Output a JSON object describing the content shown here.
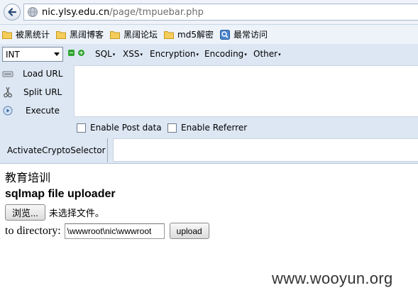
{
  "browser": {
    "url_domain": "nic.ylsy.edu.cn",
    "url_path": "/page/tmpuebar.php",
    "bookmarks": [
      {
        "label": "被黑统计",
        "icon": "folder-icon"
      },
      {
        "label": "黑阔博客",
        "icon": "folder-icon"
      },
      {
        "label": "黑阔论坛",
        "icon": "folder-icon"
      },
      {
        "label": "md5解密",
        "icon": "folder-icon"
      },
      {
        "label": "最常访问",
        "icon": "most-visited-icon"
      }
    ]
  },
  "hackbar": {
    "select_value": "INT",
    "menus": [
      "SQL",
      "XSS",
      "Encryption",
      "Encoding",
      "Other"
    ],
    "actions": {
      "load": "Load URL",
      "split": "Split URL",
      "execute": "Execute"
    },
    "checkboxes": {
      "post": "Enable Post data",
      "referrer": "Enable Referrer"
    },
    "crypto_label": "ActivateCryptoSelector"
  },
  "page": {
    "line1": "教育培训",
    "title": "sqlmap file uploader",
    "browse_label": "浏览...",
    "no_file_text": "未选择文件。",
    "dir_label": "to directory:",
    "dir_value": "\\wwwroot\\nic\\wwwroot",
    "upload_label": "upload"
  },
  "watermark": "www.wooyun.org",
  "colors": {
    "toolbar_bg": "#dde7f3",
    "chrome_bg": "#eef3fa",
    "accent_green": "#2ea52e"
  }
}
